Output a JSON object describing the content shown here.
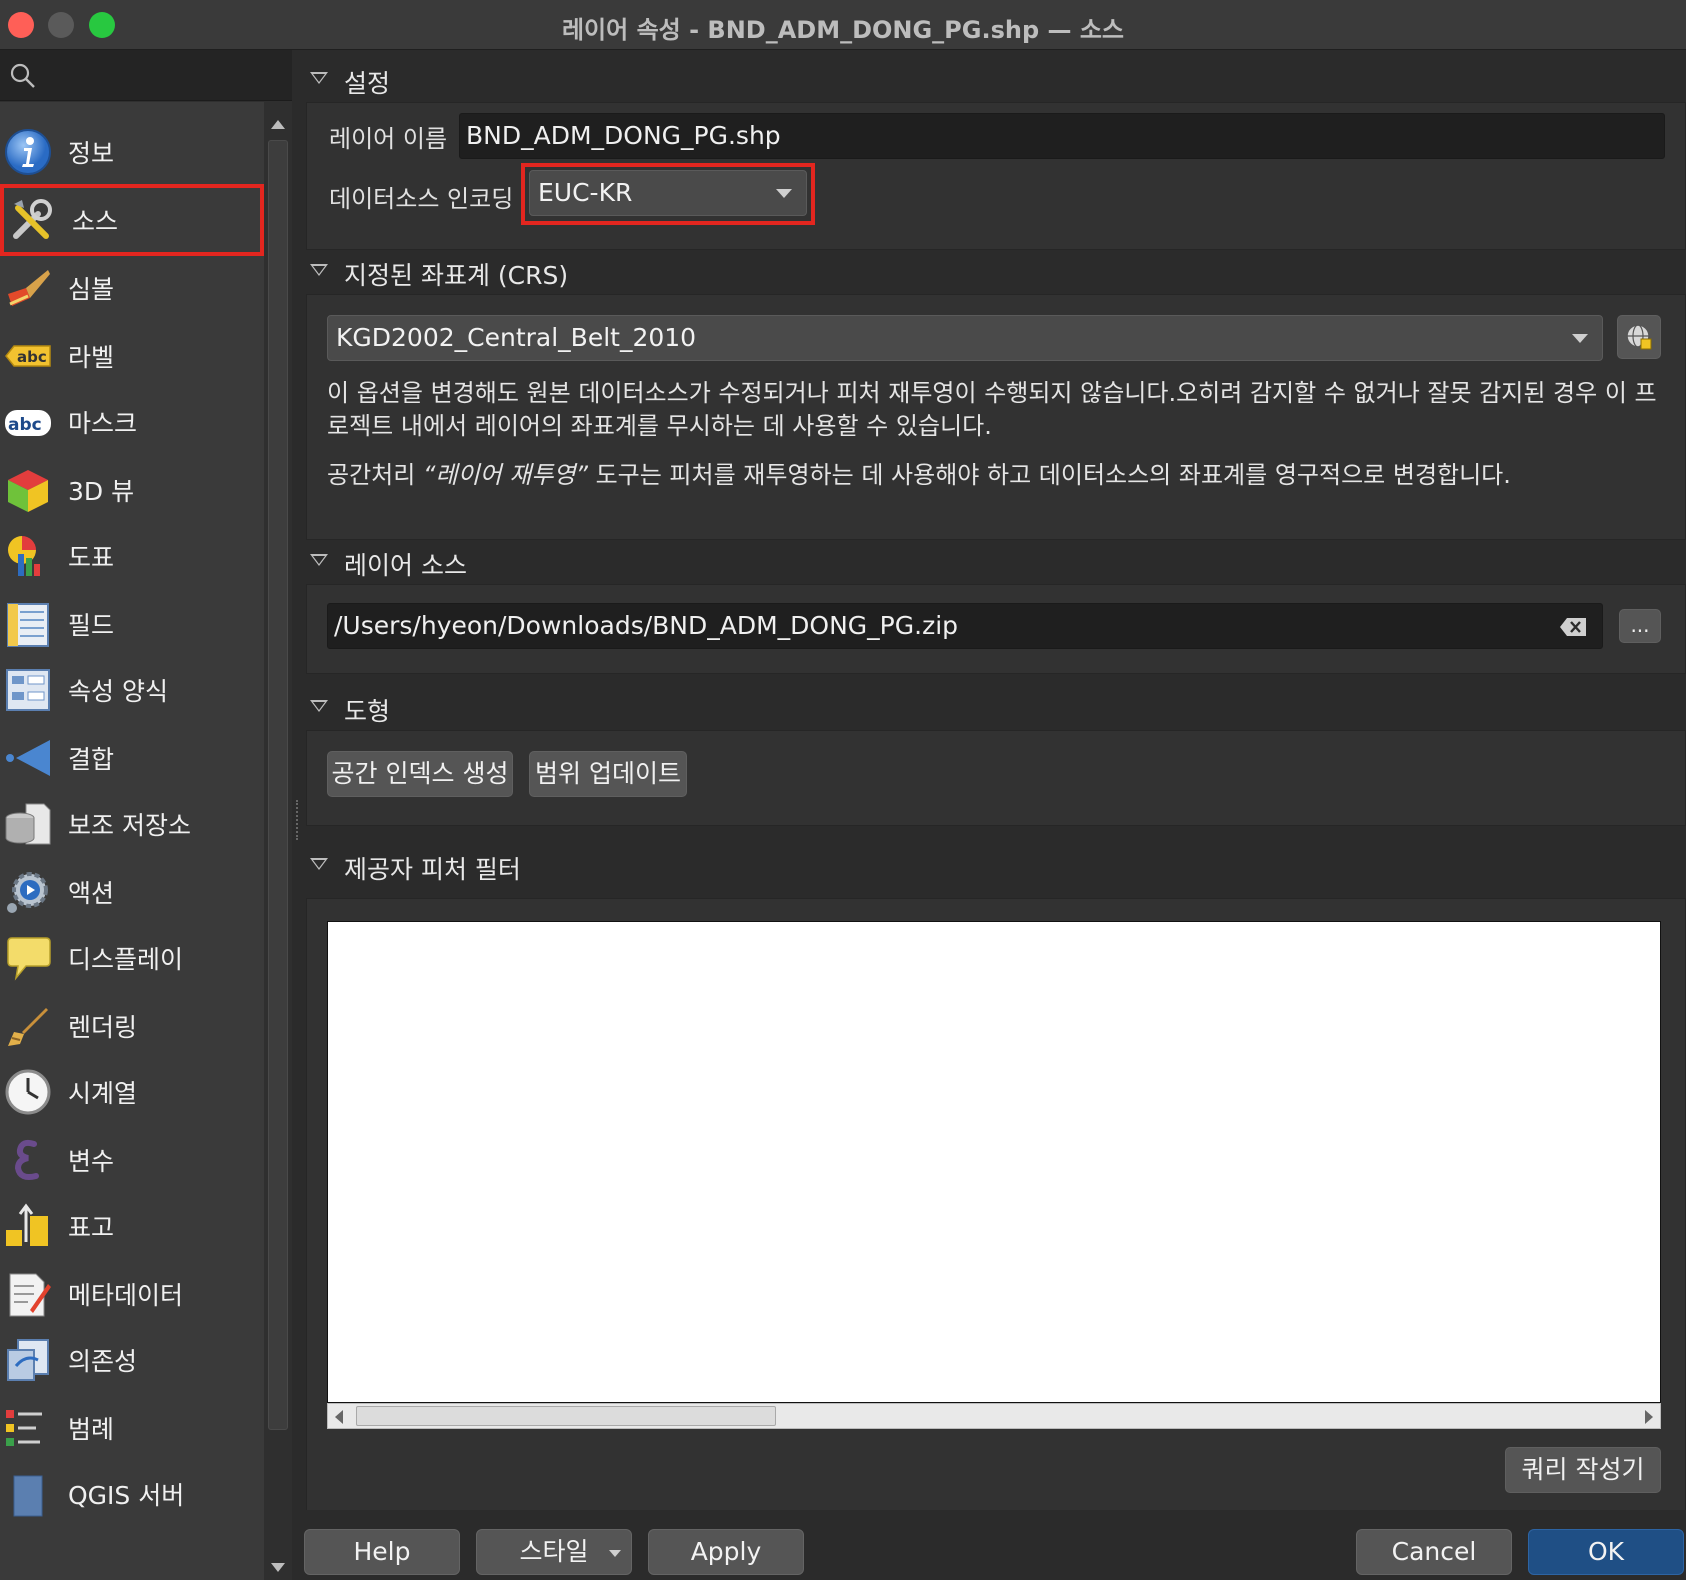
{
  "window": {
    "title": "레이어 속성 - BND_ADM_DONG_PG.shp — 소스"
  },
  "search": {
    "placeholder": ""
  },
  "sidebar": {
    "items": [
      {
        "label": "정보",
        "icon": "info-icon"
      },
      {
        "label": "소스",
        "icon": "source-tools-icon",
        "selected": true
      },
      {
        "label": "심볼",
        "icon": "symbology-brush-icon"
      },
      {
        "label": "라벨",
        "icon": "labels-abc-icon"
      },
      {
        "label": "마스크",
        "icon": "mask-abc-icon"
      },
      {
        "label": "3D 뷰",
        "icon": "3d-cube-icon"
      },
      {
        "label": "도표",
        "icon": "diagram-icon"
      },
      {
        "label": "필드",
        "icon": "fields-icon"
      },
      {
        "label": "속성 양식",
        "icon": "attributes-form-icon"
      },
      {
        "label": "결합",
        "icon": "joins-icon"
      },
      {
        "label": "보조 저장소",
        "icon": "auxiliary-storage-icon"
      },
      {
        "label": "액션",
        "icon": "actions-gear-icon"
      },
      {
        "label": "디스플레이",
        "icon": "display-speech-icon"
      },
      {
        "label": "렌더링",
        "icon": "rendering-brush-icon"
      },
      {
        "label": "시계열",
        "icon": "temporal-clock-icon"
      },
      {
        "label": "변수",
        "icon": "variables-icon"
      },
      {
        "label": "표고",
        "icon": "elevation-icon"
      },
      {
        "label": "메타데이터",
        "icon": "metadata-icon"
      },
      {
        "label": "의존성",
        "icon": "dependencies-icon"
      },
      {
        "label": "범례",
        "icon": "legend-icon"
      },
      {
        "label": "QGIS 서버",
        "icon": "qgis-server-icon"
      }
    ]
  },
  "settings": {
    "header": "설정",
    "layer_name_label": "레이어 이름",
    "layer_name_value": "BND_ADM_DONG_PG.shp",
    "encoding_label": "데이터소스 인코딩",
    "encoding_value": "EUC-KR"
  },
  "crs": {
    "header": "지정된 좌표계 (CRS)",
    "value": "KGD2002_Central_Belt_2010",
    "note1": "이 옵션을 변경해도 원본 데이터소스가 수정되거나 피처 재투영이 수행되지 않습니다.오히려 감지할 수 없거나 잘못 감지된 경우 이 프로젝트 내에서 레이어의 좌표계를 무시하는 데 사용할 수 있습니다.",
    "note2_prefix": "공간처리 ",
    "note2_tool": "“레이어 재투영”",
    "note2_suffix": " 도구는 피처를 재투영하는 데 사용해야 하고 데이터소스의 좌표계를 영구적으로 변경합니다."
  },
  "layer_source": {
    "header": "레이어 소스",
    "path": "/Users/hyeon/Downloads/BND_ADM_DONG_PG.zip",
    "browse_label": "..."
  },
  "geometry": {
    "header": "도형",
    "spatial_index_button": "공간 인덱스 생성",
    "update_extent_button": "범위 업데이트"
  },
  "provider_filter": {
    "header": "제공자 피처 필터",
    "query_builder_button": "쿼리 작성기"
  },
  "footer": {
    "help": "Help",
    "style": "스타일",
    "apply": "Apply",
    "cancel": "Cancel",
    "ok": "OK"
  },
  "colors": {
    "highlight_red": "#e3261f",
    "ok_button": "#1f4f85"
  }
}
